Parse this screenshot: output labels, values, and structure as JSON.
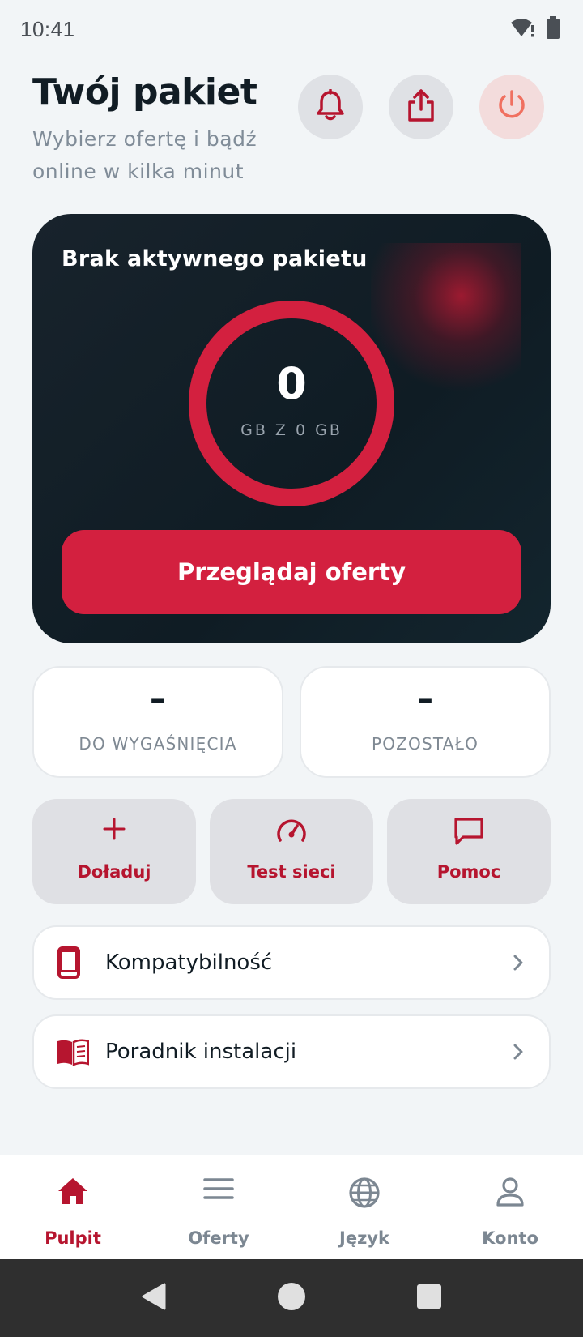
{
  "status_bar": {
    "time": "10:41",
    "wifi_icon": "wifi-alert-icon",
    "battery_icon": "battery-icon"
  },
  "header": {
    "title": "Twój pakiet",
    "subtitle": "Wybierz ofertę i bądź online w kilka minut",
    "actions": [
      {
        "name": "notifications",
        "icon": "bell-icon"
      },
      {
        "name": "share",
        "icon": "share-icon"
      },
      {
        "name": "logout",
        "icon": "power-icon"
      }
    ]
  },
  "package": {
    "title": "Brak aktywnego pakietu",
    "used_value": "0",
    "unit_label": "GB Z 0 GB",
    "used_fraction": 0,
    "button_label": "Przeglądaj oferty"
  },
  "stats": {
    "expiry": {
      "value": "–",
      "label": "DO WYGAŚNIĘCIA"
    },
    "remaining": {
      "value": "–",
      "label": "POZOSTAŁO"
    }
  },
  "quick_actions": {
    "topup": {
      "label": "Doładuj",
      "icon": "plus-icon"
    },
    "speed_test": {
      "label": "Test sieci",
      "icon": "speedometer-icon"
    },
    "help": {
      "label": "Pomoc",
      "icon": "chat-bubble-icon"
    }
  },
  "list": {
    "compatibility": {
      "label": "Kompatybilność",
      "icon": "phone-icon"
    },
    "install_guide": {
      "label": "Poradnik instalacji",
      "icon": "book-icon"
    }
  },
  "bottom_nav": {
    "dashboard": {
      "label": "Pulpit",
      "icon": "home-icon",
      "active": true
    },
    "offers": {
      "label": "Oferty",
      "icon": "menu-icon",
      "active": false
    },
    "language": {
      "label": "Język",
      "icon": "globe-icon",
      "active": false
    },
    "account": {
      "label": "Konto",
      "icon": "user-icon",
      "active": false
    }
  },
  "colors": {
    "accent": "#d3203f",
    "accent_dark": "#b6152f",
    "card_bg": "#13202a",
    "page_bg": "#f2f5f7"
  }
}
